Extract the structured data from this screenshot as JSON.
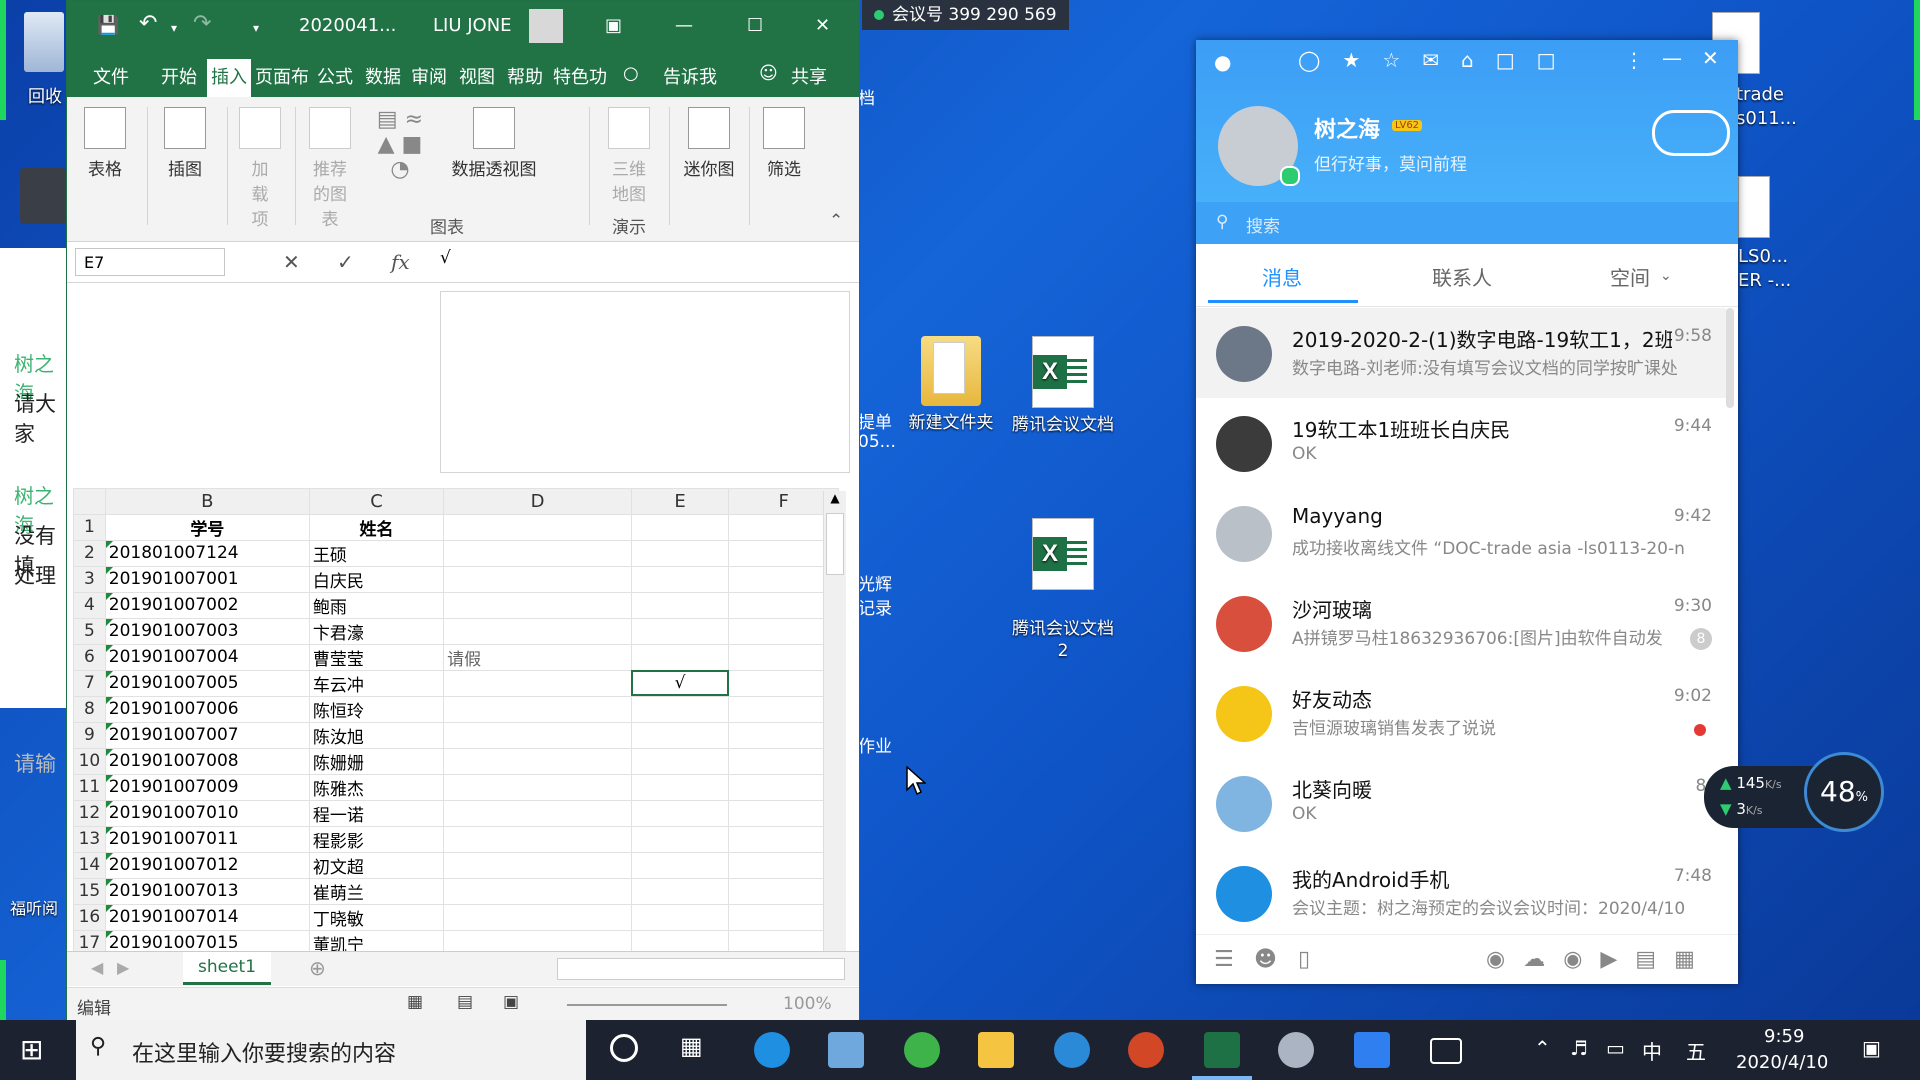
{
  "meeting": {
    "label": "会议号 399 290 569"
  },
  "desktop": {
    "left_icons": [
      {
        "label": "回收"
      }
    ],
    "left_bottom": "福听阅",
    "chat_snippets": [
      "树之海",
      "请大家",
      "树之海",
      "没有填",
      "处理",
      "请输"
    ],
    "partial_labels": [
      "档",
      "提单",
      "05...",
      "光辉",
      "记录",
      "作业"
    ],
    "right_labels": [
      "trade",
      "s011...",
      "LS0...",
      "ER -..."
    ],
    "icons": [
      {
        "label": "新建文件夹"
      },
      {
        "label": "腾讯会议文档"
      },
      {
        "label": "腾讯会议文档\n2"
      }
    ]
  },
  "excel": {
    "title": "2020041...",
    "user": "LIU JONE",
    "menu": [
      "文件",
      "开始",
      "插入",
      "页面布",
      "公式",
      "数据",
      "审阅",
      "视图",
      "帮助",
      "特色功"
    ],
    "tell": "告诉我",
    "share": "共享",
    "ribbon": {
      "table": "表格",
      "illustration": "插图",
      "addins": "加载项",
      "recommended": "推荐的图表",
      "pivot": "数据透视图",
      "map3d": "三维地图",
      "sparkline": "迷你图",
      "filter": "筛选",
      "group_charts": "图表",
      "group_tour": "演示"
    },
    "name_box": "E7",
    "formula": "√",
    "columns": [
      "B",
      "C",
      "D",
      "E",
      "F"
    ],
    "rows": [
      {
        "n": "1",
        "b": "学号",
        "c": "姓名",
        "d": "",
        "e": ""
      },
      {
        "n": "2",
        "b": "201801007124",
        "c": "王硕",
        "d": "",
        "e": ""
      },
      {
        "n": "3",
        "b": "201901007001",
        "c": "白庆民",
        "d": "",
        "e": ""
      },
      {
        "n": "4",
        "b": "201901007002",
        "c": "鲍雨",
        "d": "",
        "e": ""
      },
      {
        "n": "5",
        "b": "201901007003",
        "c": "卞君濠",
        "d": "",
        "e": ""
      },
      {
        "n": "6",
        "b": "201901007004",
        "c": "曹莹莹",
        "d": "请假",
        "e": ""
      },
      {
        "n": "7",
        "b": "201901007005",
        "c": "车云冲",
        "d": "",
        "e": "√"
      },
      {
        "n": "8",
        "b": "201901007006",
        "c": "陈恒玲",
        "d": "",
        "e": ""
      },
      {
        "n": "9",
        "b": "201901007007",
        "c": "陈汝旭",
        "d": "",
        "e": ""
      },
      {
        "n": "10",
        "b": "201901007008",
        "c": "陈姗姗",
        "d": "",
        "e": ""
      },
      {
        "n": "11",
        "b": "201901007009",
        "c": "陈雅杰",
        "d": "",
        "e": ""
      },
      {
        "n": "12",
        "b": "201901007010",
        "c": "程一诺",
        "d": "",
        "e": ""
      },
      {
        "n": "13",
        "b": "201901007011",
        "c": "程影影",
        "d": "",
        "e": ""
      },
      {
        "n": "14",
        "b": "201901007012",
        "c": "初文超",
        "d": "",
        "e": ""
      },
      {
        "n": "15",
        "b": "201901007013",
        "c": "崔萌兰",
        "d": "",
        "e": ""
      },
      {
        "n": "16",
        "b": "201901007014",
        "c": "丁晓敏",
        "d": "",
        "e": ""
      },
      {
        "n": "17",
        "b": "201901007015",
        "c": "董凯宁",
        "d": "",
        "e": ""
      }
    ],
    "sheet": "sheet1",
    "status": "编辑",
    "zoom": "100%"
  },
  "qq": {
    "name": "树之海",
    "level": "LV62",
    "signature": "但行好事，莫问前程",
    "search": "搜索",
    "tabs": [
      "消息",
      "联系人",
      "空间"
    ],
    "conversations": [
      {
        "name": "2019-2020-2-(1)数字电路-19软工1，2班",
        "msg": "数字电路-刘老师:没有填写会议文档的同学按旷课处",
        "time": "9:58"
      },
      {
        "name": "19软工本1班班长白庆民",
        "msg": "OK",
        "time": "9:44"
      },
      {
        "name": "Mayyang",
        "msg": "成功接收离线文件 “DOC-trade  asia  -ls0113-20-n",
        "time": "9:42"
      },
      {
        "name": "沙河玻璃",
        "msg": "A拼镜罗马柱18632936706:[图片]由软件自动发",
        "time": "9:30",
        "badge": "8"
      },
      {
        "name": "好友动态",
        "msg": "吉恒源玻璃销售发表了说说",
        "time": "9:02"
      },
      {
        "name": "北葵向暖",
        "msg": "OK",
        "time": "8:"
      },
      {
        "name": "我的Android手机",
        "msg": "会议主题：树之海预定的会议会议时间：2020/4/10",
        "time": "7:48"
      }
    ]
  },
  "speed": {
    "up": "145",
    "up_unit": "K/s",
    "down": "3",
    "down_unit": "K/s",
    "percent": "48",
    "percent_unit": "%"
  },
  "taskbar": {
    "search_placeholder": "在这里输入你要搜索的内容",
    "ime1": "中",
    "ime2": "五",
    "time": "9:59",
    "date": "2020/4/10"
  }
}
